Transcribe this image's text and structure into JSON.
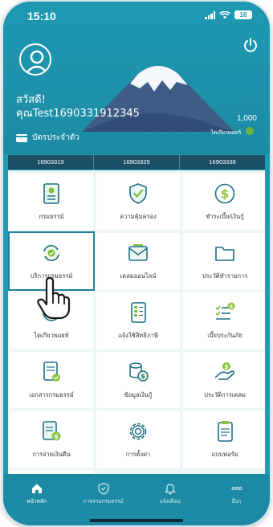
{
  "status": {
    "time": "15:10",
    "battery": "16"
  },
  "header": {
    "greeting": "สวัสดี!",
    "user_name": "คุณTest1690331912345",
    "card_label": "บัตรประจำตัว",
    "points_value": "1,000",
    "points_label": "ไดเกียวพอยท์"
  },
  "policies": [
    "16903319",
    "16903329",
    "16903338"
  ],
  "menu": [
    {
      "label": "กรมธรรม์",
      "icon": "document-icon"
    },
    {
      "label": "ความคุ้มครอง",
      "icon": "shield-check-icon"
    },
    {
      "label": "ชำระเบี้ย/เงินกู้",
      "icon": "dollar-circle-icon"
    },
    {
      "label": "บริการกรมธรรม์",
      "icon": "refresh-check-icon"
    },
    {
      "label": "เคลมออนไลน์",
      "icon": "envelope-icon"
    },
    {
      "label": "ประวัติทำรายการ",
      "icon": "folder-icon"
    },
    {
      "label": "ไดเกียวพอยท์",
      "icon": "points-icon"
    },
    {
      "label": "แจ้งใช้สิทธิภาษี",
      "icon": "tax-document-icon"
    },
    {
      "label": "เบี้ยประกันภัย",
      "icon": "checklist-dollar-icon"
    },
    {
      "label": "เอกสารกรมธรรม์",
      "icon": "document-check-icon"
    },
    {
      "label": "ข้อมูลเงินกู้",
      "icon": "coins-icon"
    },
    {
      "label": "ประวัติการเคลม",
      "icon": "hand-coin-icon"
    },
    {
      "label": "การจ่ายเงินคืน",
      "icon": "refund-document-icon"
    },
    {
      "label": "การตั้งค่า",
      "icon": "gear-icon"
    },
    {
      "label": "แบบฟอร์ม",
      "icon": "form-icon"
    }
  ],
  "nav": [
    {
      "label": "หน้าหลัก",
      "icon": "home-icon"
    },
    {
      "label": "ภาพรวมกรมธรรม์",
      "icon": "shield-icon"
    },
    {
      "label": "แจ้งเตือน",
      "icon": "bell-icon"
    },
    {
      "label": "อื่นๆ",
      "icon": "more-icon"
    }
  ],
  "colors": {
    "primary": "#1e98b1",
    "strip": "#1b4f66",
    "accent_green": "#6fb33b",
    "selected_border": "#1f7fa0"
  }
}
